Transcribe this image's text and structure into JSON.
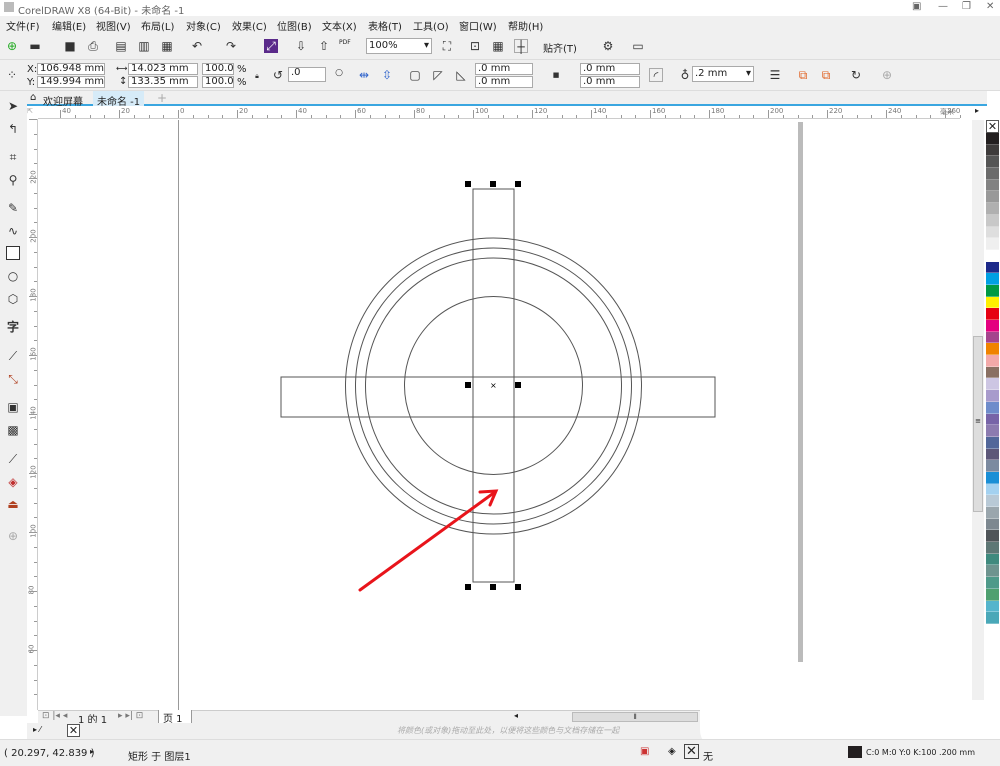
{
  "window": {
    "title": "CorelDRAW X8 (64-Bit) - 未命名 -1",
    "minimize": "—",
    "maximize": "❐",
    "close": "✕",
    "help": "▣"
  },
  "menu": [
    "文件(F)",
    "编辑(E)",
    "视图(V)",
    "布局(L)",
    "对象(C)",
    "效果(C)",
    "位图(B)",
    "文本(X)",
    "表格(T)",
    "工具(O)",
    "窗口(W)",
    "帮助(H)"
  ],
  "toolbar": {
    "zoom": "100%",
    "snap": "贴齐(T)",
    "pdf": "PDF"
  },
  "property_bar": {
    "x_label": "X:",
    "x": "106.948 mm",
    "y_label": "Y:",
    "y": "149.994 mm",
    "width": "14.023 mm",
    "height": "133.35 mm",
    "scale_x": "100.0",
    "scale_y": "100.0",
    "pct": "%",
    "rotation": ".0",
    "corner1": ".0 mm",
    "corner2": ".0 mm",
    "corner3": ".0 mm",
    "corner4": ".0 mm",
    "outline": ".2 mm"
  },
  "tabs": {
    "welcome": "欢迎屏幕",
    "document": "未命名 -1",
    "add": "+"
  },
  "rulers": {
    "h_labels": [
      "40",
      "20",
      "0",
      "20",
      "40",
      "60",
      "80",
      "100",
      "120",
      "140",
      "160",
      "180",
      "200",
      "220",
      "240",
      "260"
    ],
    "h_unit": "毫米",
    "v_labels": [
      "220",
      "200",
      "180",
      "160",
      "140",
      "120",
      "100",
      "80",
      "60"
    ]
  },
  "page_nav": {
    "counter": "1 的 1",
    "page_tab": "页 1"
  },
  "doc_palette_hint": "将颜色(或对象)拖动至此处，以便将这些颜色与文档存储在一起",
  "status": {
    "coords": "( 20.297, 42.839 )",
    "object": "矩形 于 图层1",
    "fill": "无",
    "outline": "C:0 M:0 Y:0 K:100  .200 mm"
  },
  "palette": [
    "#231f20",
    "#3e3b3b",
    "#555555",
    "#6b6b6b",
    "#828282",
    "#999999",
    "#b0b0b0",
    "#c8c8c8",
    "#dedede",
    "#efefef",
    "#ffffff",
    "#1d2a8a",
    "#00a0e3",
    "#009944",
    "#fff000",
    "#e60012",
    "#e4007f",
    "#a5448d",
    "#f08300",
    "#f3a9a9",
    "#8a7063",
    "#cdc6e3",
    "#a89bcc",
    "#6f8ccb",
    "#7764a8",
    "#8c7bb0",
    "#52679a",
    "#5d5779",
    "#7b8aa0",
    "#1a8fd6",
    "#a3d1f0",
    "#b8c9d6",
    "#9aa6ad",
    "#7d8890",
    "#4f5458",
    "#5e7775",
    "#3f8a7e",
    "#6e948f",
    "#4f9a8a",
    "#4fa070",
    "#55b5cc",
    "#4aa8b8"
  ],
  "colors": {
    "accent": "#3aa6e0",
    "arrow": "#e8141b"
  }
}
